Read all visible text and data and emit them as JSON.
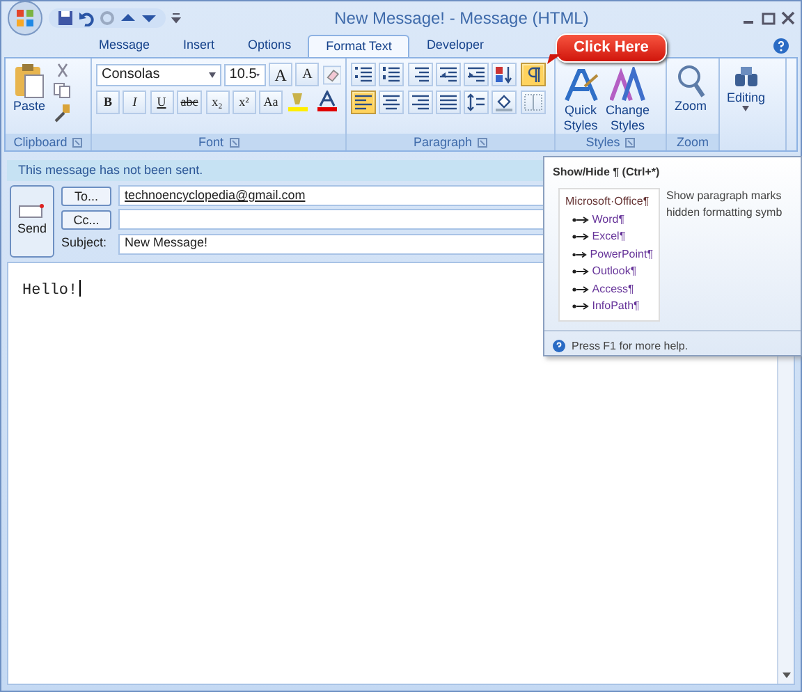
{
  "window": {
    "title": "New Message! - Message (HTML)"
  },
  "tabs": [
    {
      "label": "Message",
      "selected": false
    },
    {
      "label": "Insert",
      "selected": false
    },
    {
      "label": "Options",
      "selected": false
    },
    {
      "label": "Format Text",
      "selected": true
    },
    {
      "label": "Developer",
      "selected": false
    }
  ],
  "ribbon": {
    "clipboard": {
      "label": "Clipboard",
      "paste": "Paste"
    },
    "font": {
      "label": "Font",
      "font_name": "Consolas",
      "font_size": "10.5",
      "grow": "A",
      "shrink": "A",
      "format_buttons": [
        "B",
        "I",
        "U",
        "abc",
        "x₂",
        "x²",
        "Aa"
      ]
    },
    "paragraph": {
      "label": "Paragraph",
      "rows": [
        [
          {
            "kind": "bullets",
            "selected": false
          },
          {
            "kind": "numbering",
            "selected": false
          },
          {
            "kind": "multilevel",
            "selected": false
          },
          {
            "kind": "outdent",
            "selected": false
          },
          {
            "kind": "indent",
            "selected": false
          },
          {
            "kind": "sort",
            "selected": false
          },
          {
            "kind": "pilcrow",
            "selected": true
          }
        ],
        [
          {
            "kind": "align-left",
            "selected": true
          },
          {
            "kind": "align-center",
            "selected": false
          },
          {
            "kind": "align-right",
            "selected": false
          },
          {
            "kind": "justify",
            "selected": false
          },
          {
            "kind": "spacing",
            "selected": false
          },
          {
            "kind": "shading",
            "selected": false
          },
          {
            "kind": "borders",
            "selected": false
          }
        ]
      ]
    },
    "styles": {
      "label": "Styles",
      "quick": [
        "Quick",
        "Styles"
      ],
      "change": [
        "Change",
        "Styles"
      ]
    },
    "zoom": {
      "label": "Zoom",
      "button": "Zoom"
    },
    "editing": {
      "button": "Editing"
    }
  },
  "callout": "Click Here",
  "infobar": "This message has not been sent.",
  "header": {
    "send": "Send",
    "to_button": "To...",
    "cc_button": "Cc...",
    "subject_label": "Subject:",
    "to_value": "technoencyclopedia@gmail.com",
    "subject_value": "New Message!"
  },
  "body": "Hello!",
  "tooltip": {
    "title": "Show/Hide ¶ (Ctrl+*)",
    "example": {
      "text": "Microsoft·Office¶",
      "children": [
        {
          "text": "Word¶"
        },
        {
          "text": "Excel¶"
        },
        {
          "text": "PowerPoint¶"
        },
        {
          "text": "Outlook¶"
        },
        {
          "text": "Access¶"
        },
        {
          "text": "InfoPath¶"
        }
      ]
    },
    "description": [
      "Show paragraph marks",
      "hidden formatting symb"
    ],
    "help": "Press F1 for more help."
  }
}
